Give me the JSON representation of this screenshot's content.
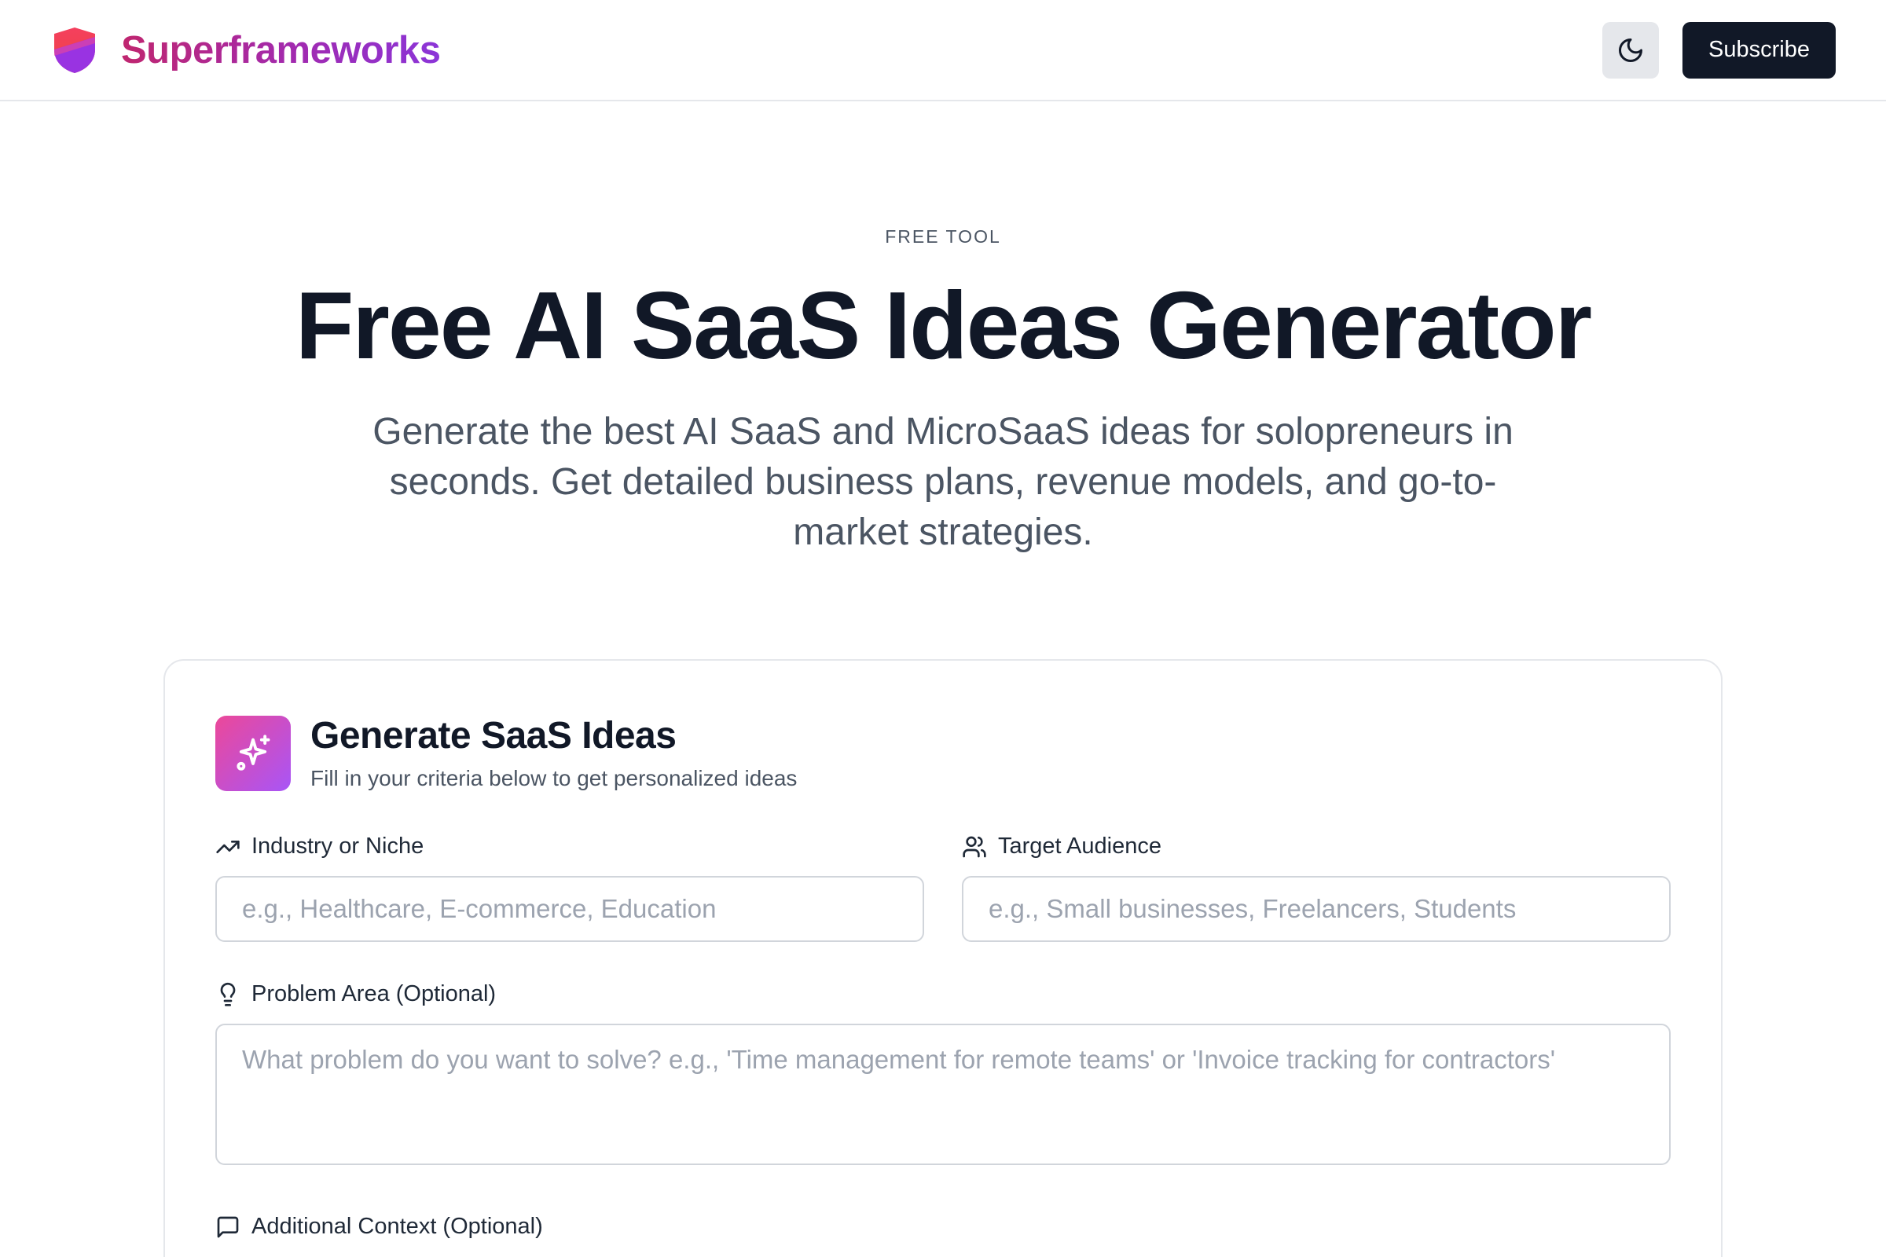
{
  "header": {
    "brand_name": "Superframeworks",
    "subscribe_label": "Subscribe"
  },
  "hero": {
    "eyebrow": "FREE TOOL",
    "title": "Free AI SaaS Ideas Generator",
    "subtitle": "Generate the best AI SaaS and MicroSaaS ideas for solopreneurs in seconds. Get detailed business plans, revenue models, and go-to-market strategies."
  },
  "card": {
    "title": "Generate SaaS Ideas",
    "subtitle": "Fill in your criteria below to get personalized ideas",
    "fields": {
      "industry": {
        "label": "Industry or Niche",
        "placeholder": "e.g., Healthcare, E-commerce, Education",
        "value": ""
      },
      "audience": {
        "label": "Target Audience",
        "placeholder": "e.g., Small businesses, Freelancers, Students",
        "value": ""
      },
      "problem": {
        "label": "Problem Area (Optional)",
        "placeholder": "What problem do you want to solve? e.g., 'Time management for remote teams' or 'Invoice tracking for contractors'",
        "value": ""
      },
      "context": {
        "label": "Additional Context (Optional)"
      }
    }
  },
  "icons": {
    "logo": "shield-logo-icon",
    "theme_toggle": "moon-icon",
    "card": "sparkles-icon",
    "industry": "trending-up-icon",
    "audience": "users-icon",
    "problem": "lightbulb-icon",
    "context": "message-square-icon"
  },
  "colors": {
    "brand_gradient_start": "#c0266f",
    "brand_gradient_end": "#8b35d8",
    "primary_button": "#111827",
    "card_icon_gradient_start": "#ec4899",
    "card_icon_gradient_end": "#a855f7",
    "placeholder": "#9ca3af",
    "border": "#d1d5db"
  }
}
